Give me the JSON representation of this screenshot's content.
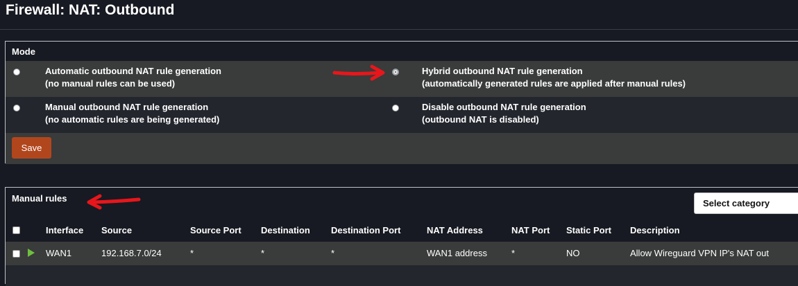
{
  "page": {
    "title": "Firewall: NAT: Outbound"
  },
  "mode": {
    "heading": "Mode",
    "options": [
      {
        "line1": "Automatic outbound NAT rule generation",
        "line2": "(no manual rules can be used)",
        "checked": false
      },
      {
        "line1": "Hybrid outbound NAT rule generation",
        "line2": "(automatically generated rules are applied after manual rules)",
        "checked": true
      },
      {
        "line1": "Manual outbound NAT rule generation",
        "line2": "(no automatic rules are being generated)",
        "checked": false
      },
      {
        "line1": "Disable outbound NAT rule generation",
        "line2": "(outbound NAT is disabled)",
        "checked": false
      }
    ],
    "save_label": "Save"
  },
  "manual_rules": {
    "heading": "Manual rules",
    "select_category": "Select category",
    "columns": [
      "Interface",
      "Source",
      "Source Port",
      "Destination",
      "Destination Port",
      "NAT Address",
      "NAT Port",
      "Static Port",
      "Description"
    ],
    "rows": [
      {
        "interface": "WAN1",
        "source": "192.168.7.0/24",
        "source_port": "*",
        "destination": "*",
        "destination_port": "*",
        "nat_address": "WAN1 address",
        "nat_port": "*",
        "static_port": "NO",
        "description": "Allow Wireguard VPN IP's NAT out"
      }
    ]
  },
  "colors": {
    "accent_button": "#b1461d",
    "annotation_arrow": "#e8161b",
    "enabled_icon": "#6fbf3f"
  },
  "icons": [
    "radio-button",
    "checkbox",
    "play-icon",
    "red-arrow-annotation"
  ]
}
